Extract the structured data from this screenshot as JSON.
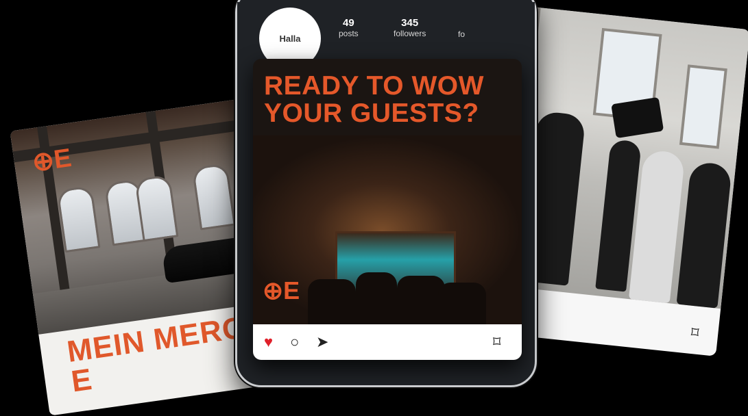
{
  "profile": {
    "avatar_text": "Halla",
    "posts_count": "49",
    "posts_label": "posts",
    "followers_count": "345",
    "followers_label": "followers",
    "following_label_partial": "fo"
  },
  "center_post": {
    "headline_line1": "READY TO WOW",
    "headline_line2": "YOUR GUESTS?",
    "logo_text": "⊕E",
    "actions": {
      "like_icon": "heart-icon",
      "comment_icon": "comment-icon",
      "share_icon": "send-icon",
      "save_icon": "bookmark-icon"
    }
  },
  "left_card": {
    "logo_text": "⊕E",
    "headline_line1": "MEIN MERCED",
    "headline_line2": "E"
  },
  "colors": {
    "brand_orange": "#e5582a",
    "background": "#000000"
  }
}
